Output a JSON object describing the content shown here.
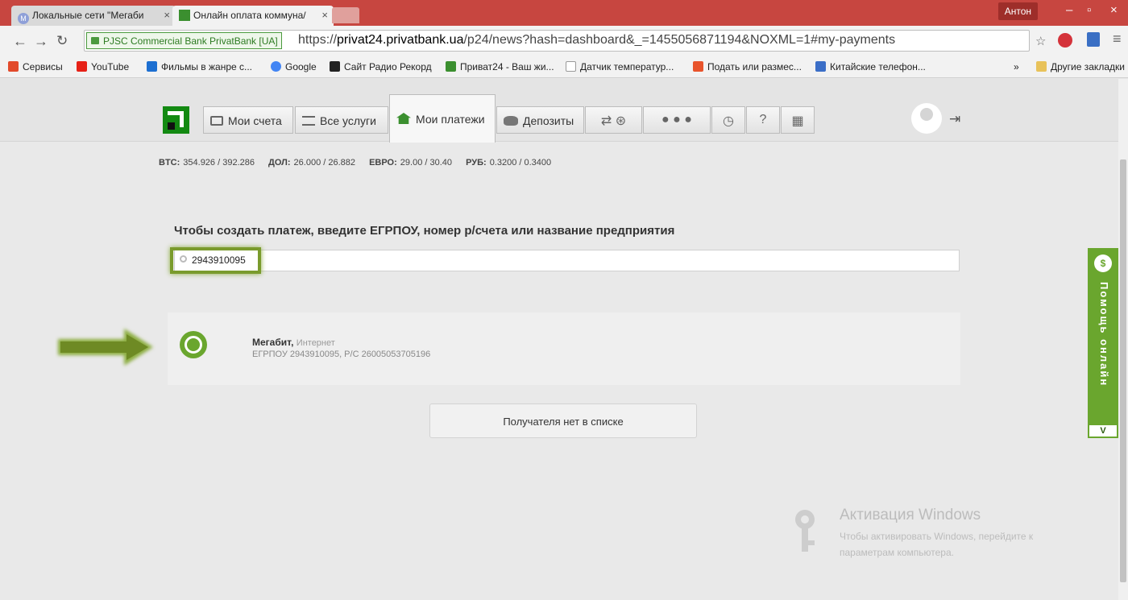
{
  "browser": {
    "tabs": [
      {
        "title": "Локальные сети \"Мегаби",
        "favicon": "M"
      },
      {
        "title": "Онлайн оплата коммуна/",
        "favicon": "privat-icon"
      }
    ],
    "user": "Антон",
    "url": {
      "secure_label": "PJSC Commercial Bank PrivatBank [UA]",
      "prefix": "https://",
      "domain": "privat24.privatbank.ua",
      "path": "/p24/news?hash=dashboard&_=1455056871194&NOXML=1#my-payments"
    },
    "bookmarks": [
      {
        "label": "Сервисы",
        "icon": "apps-icon",
        "color": "#e24a2b"
      },
      {
        "label": "YouTube",
        "icon": "youtube-icon",
        "color": "#e62117"
      },
      {
        "label": "Фильмы в жанре с...",
        "icon": "arrow-up-icon",
        "color": "#1d6fd1"
      },
      {
        "label": "Google",
        "icon": "google-icon",
        "color": "#4285f4"
      },
      {
        "label": "Сайт Радио Рекорд",
        "icon": "record-icon",
        "color": "#222222"
      },
      {
        "label": "Приват24 - Ваш жи...",
        "icon": "privat-icon",
        "color": "#3b8f2f"
      },
      {
        "label": "Датчик температур...",
        "icon": "page-icon",
        "color": "#9a9a9a"
      },
      {
        "label": "Подать или размес...",
        "icon": "info-icon",
        "color": "#e8542c"
      },
      {
        "label": "Китайские телефон...",
        "icon": "phone-icon",
        "color": "#3b6ec7"
      }
    ],
    "bookmarks_more": "»",
    "other_bookmarks": "Другие закладки"
  },
  "nav": {
    "tabs": [
      {
        "label": "Мои счета",
        "icon": "card-icon"
      },
      {
        "label": "Все услуги",
        "icon": "list-icon"
      },
      {
        "label": "Мои платежи",
        "icon": "home-icon"
      },
      {
        "label": "Депозиты",
        "icon": "piggy-bank-icon"
      }
    ]
  },
  "rates": [
    {
      "name": "BTC:",
      "value": "354.926 / 392.286"
    },
    {
      "name": "ДОЛ:",
      "value": "26.000 / 26.882"
    },
    {
      "name": "ЕВРО:",
      "value": "29.00 / 30.40"
    },
    {
      "name": "РУБ:",
      "value": "0.3200 / 0.3400"
    }
  ],
  "payment": {
    "prompt": "Чтобы создать платеж, введите ЕГРПОУ, номер р/счета или название предприятия",
    "search_value": "2943910095"
  },
  "result": {
    "name": "Мегабит,",
    "category": "Интернет",
    "details": "ЕГРПОУ 2943910095, Р/С 26005053705196"
  },
  "no_recipient_button": "Получателя нет в списке",
  "help": {
    "label": "Помощь онлайн",
    "toggle": "V"
  },
  "windows_activation": {
    "title": "Активация Windows",
    "line1": "Чтобы активировать Windows, перейдите к",
    "line2": "параметрам компьютера."
  },
  "colors": {
    "brand_green": "#6aa62e",
    "chrome_red": "#c74640"
  }
}
